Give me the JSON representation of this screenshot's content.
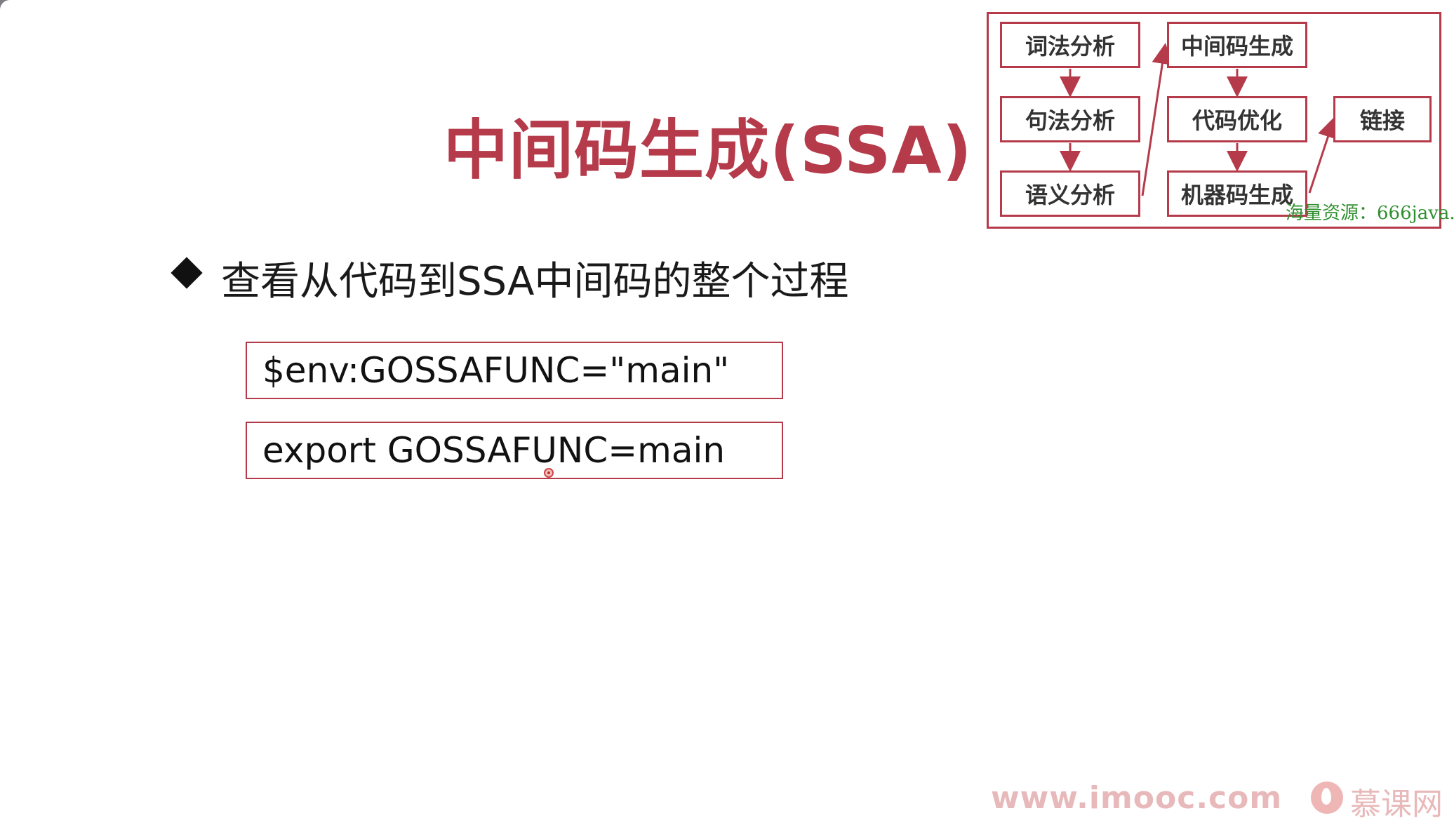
{
  "slide": {
    "title": "中间码生成(SSA)",
    "bullet": "查看从代码到SSA中间码的整个过程",
    "code_lines": [
      "$env:GOSSAFUNC=\"main\"",
      "export GOSSAFUNC=main"
    ]
  },
  "flowchart": {
    "nodes": {
      "lexical": "词法分析",
      "syntax": "句法分析",
      "semantic": "语义分析",
      "ir_gen": "中间码生成",
      "optimize": "代码优化",
      "machine_gen": "机器码生成",
      "link": "链接"
    }
  },
  "watermark": "海量资源：666java.",
  "footer": {
    "url": "www.imooc.com",
    "brand": "慕课网"
  },
  "colors": {
    "accent": "#b53a4a",
    "footer": "#e8b9ba",
    "watermark": "#2f8f2f"
  }
}
